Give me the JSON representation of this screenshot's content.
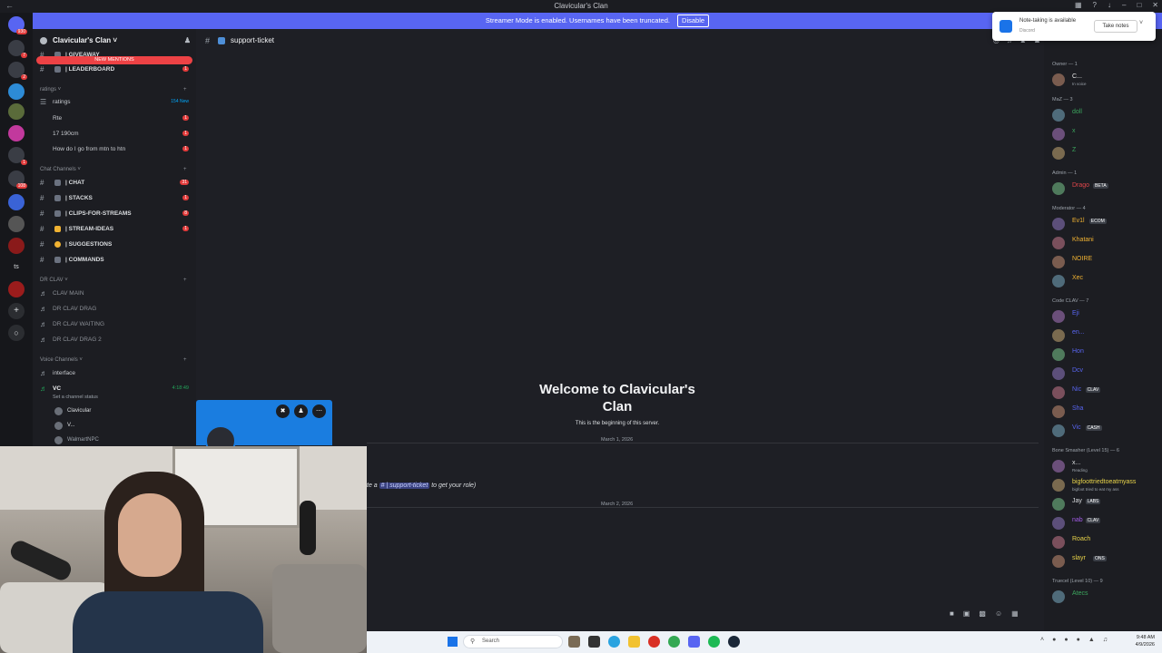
{
  "window": {
    "title": "Clavicular's Clan"
  },
  "streamer_bar": {
    "text": "Streamer Mode is enabled. Usernames have been truncated.",
    "disable_label": "Disable"
  },
  "guild": {
    "name": "Clavicular's Clan",
    "mentions_label": "NEW MENTIONS"
  },
  "channels_top": [
    {
      "name": "| GIVEAWAY",
      "count": ""
    },
    {
      "name": "| LEADERBOARD",
      "count": "1"
    }
  ],
  "ratings_category": "ratings",
  "ratings_forum": {
    "name": "ratings",
    "new_label": "154 New"
  },
  "threads": [
    {
      "name": "Rte",
      "count": "1"
    },
    {
      "name": "17 190cm",
      "count": "1"
    },
    {
      "name": "How do I go from mtn to htn",
      "count": "1"
    }
  ],
  "chat_category": "Chat Channels",
  "chat_channels": [
    {
      "name": "| CHAT",
      "count": "31"
    },
    {
      "name": "| STACKS",
      "count": "1"
    },
    {
      "name": "| CLIPS-for-streams",
      "count": "8"
    },
    {
      "name": "| STREAM-IDEAS",
      "count": "1"
    },
    {
      "name": "| SUGGESTIONS",
      "count": ""
    },
    {
      "name": "| COMMANDS",
      "count": ""
    }
  ],
  "drclav_category": "DR CLAV",
  "drclav_channels": [
    "CLAV MAIN",
    "DR CLAV DRAG",
    "DR CLAV WAITING",
    "DR CLAV DRAG 2"
  ],
  "voice_category": "Voice Channels",
  "voice_channels": [
    {
      "name": "interface"
    },
    {
      "name": "VC",
      "time": "4:18:49"
    }
  ],
  "voice_status_hint": "Set a channel status",
  "voice_users": [
    "Clavicular",
    "V...",
    "WalmartNPC"
  ],
  "chat": {
    "channel": "support-ticket",
    "welcome_title": "Welcome to Clavicular's Clan",
    "welcome_sub": "This is the beginning of this server.",
    "date1": "March 1, 2026",
    "date2": "March 2, 2026",
    "message_prefix": "te a",
    "message_mention": "# | support-ticket",
    "message_suffix": "to get your role)"
  },
  "members": {
    "groups": [
      {
        "label": "Owner — 1",
        "users": [
          {
            "name": "C...",
            "sub": "In voice",
            "color": "#e8e8e8"
          }
        ]
      },
      {
        "label": "MaZ — 3",
        "users": [
          {
            "name": "doll",
            "color": "#3ba55d"
          },
          {
            "name": "x",
            "color": "#3ba55d"
          },
          {
            "name": "Z",
            "color": "#3ba55d"
          }
        ]
      },
      {
        "label": "Admin — 1",
        "users": [
          {
            "name": "Drago",
            "tag": "BETA",
            "color": "#e0464b"
          }
        ]
      },
      {
        "label": "Moderator — 4",
        "users": [
          {
            "name": "Ev1l",
            "tag": "ECOM",
            "color": "#f0b232"
          },
          {
            "name": "Khatani",
            "color": "#f0b232"
          },
          {
            "name": "NOIRE",
            "color": "#f0b232"
          },
          {
            "name": "Xec",
            "color": "#f0b232"
          }
        ]
      },
      {
        "label": "Code CLAV — 7",
        "users": [
          {
            "name": "Eji",
            "color": "#5865f2"
          },
          {
            "name": "en...",
            "color": "#5865f2"
          },
          {
            "name": "Hon",
            "color": "#5865f2"
          },
          {
            "name": "Dcv",
            "color": "#5865f2"
          },
          {
            "name": "Nic",
            "tag": "CLAV",
            "color": "#5865f2"
          },
          {
            "name": "Sha",
            "color": "#5865f2"
          },
          {
            "name": "Vic",
            "tag": "CASH",
            "color": "#5865f2"
          }
        ]
      },
      {
        "label": "Bone Smasher (Level 15) — 6",
        "users": [
          {
            "name": "x...",
            "sub": "Reading",
            "color": "#dbdee1"
          },
          {
            "name": "bigfoottriedtoeatmyass",
            "sub": "bigfoot tried to eat my ass",
            "color": "#e9d44a"
          },
          {
            "name": "Jay",
            "tag": "LABS",
            "color": "#dbdee1"
          },
          {
            "name": "nab",
            "tag": "CLAV",
            "color": "#a35ce8"
          },
          {
            "name": "Roach",
            "color": "#e9d44a"
          },
          {
            "name": "slayr",
            "tag": "ONS",
            "color": "#e9d44a"
          }
        ]
      },
      {
        "label": "Truecel (Level 10) — 9",
        "users": [
          {
            "name": "Atecs",
            "color": "#3ba55d"
          }
        ]
      }
    ]
  },
  "notification": {
    "title": "Note-taking is available",
    "source": "Discord",
    "action": "Take notes"
  },
  "taskbar": {
    "search": "Search",
    "time": "9:48 AM",
    "date": "4/9/2026"
  },
  "colors": {
    "blurple": "#5865f2",
    "danger": "#ed4245",
    "bg": "#1e1f25",
    "sidebar": "#1c1d22"
  }
}
